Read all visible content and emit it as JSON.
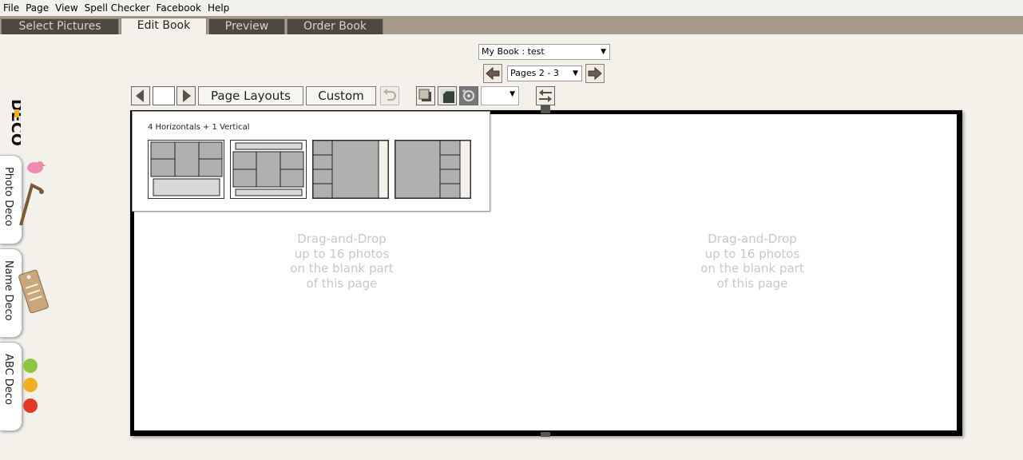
{
  "menu": [
    "File",
    "Page",
    "View",
    "Spell Checker",
    "Facebook",
    "Help"
  ],
  "tabs": [
    "Select Pictures",
    "Edit Book",
    "Preview",
    "Order Book"
  ],
  "active_tab": "Edit Book",
  "book_selector": "My Book : test",
  "pages_selector": "Pages  2 - 3",
  "toolbar": {
    "page_layouts": "Page Layouts",
    "custom": "Custom"
  },
  "layout_popup": {
    "title": "4 Horizontals + 1 Vertical"
  },
  "page_hint": "Drag-and-Drop\nup to 16 photos\non the blank part\nof this page",
  "side_tabs": [
    "Photo Deco",
    "Name Deco",
    "ABC Deco"
  ],
  "deco_logo_text": "DECO",
  "colors": {
    "tabbar": "#a89a88",
    "tab_dark": "#4d4842",
    "background": "#f3f1ea",
    "book_border": "#000000"
  }
}
